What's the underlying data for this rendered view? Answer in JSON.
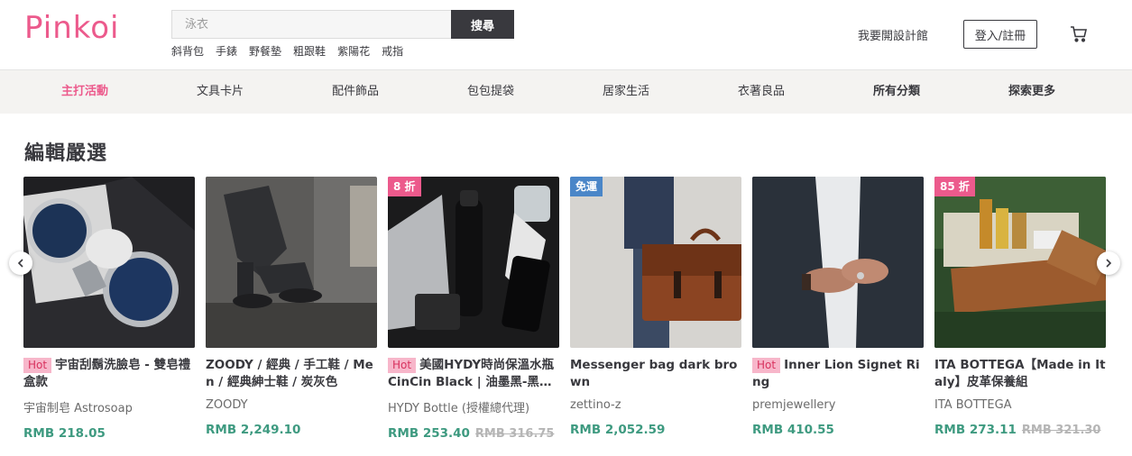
{
  "brand": {
    "logo_text": "Pinkoi",
    "color": "#ec5a8c"
  },
  "search": {
    "placeholder": "泳衣",
    "button_label": "搜尋"
  },
  "hot_words": [
    "斜背包",
    "手錶",
    "野餐墊",
    "粗跟鞋",
    "紫陽花",
    "戒指"
  ],
  "header": {
    "open_shop_label": "我要開設計館",
    "login_label": "登入/註冊",
    "cart_icon": "cart-icon"
  },
  "nav": {
    "items": [
      {
        "label": "主打活動"
      },
      {
        "label": "文具卡片"
      },
      {
        "label": "配件飾品"
      },
      {
        "label": "包包提袋"
      },
      {
        "label": "居家生活"
      },
      {
        "label": "衣著良品"
      },
      {
        "label": "所有分類"
      },
      {
        "label": "探索更多"
      }
    ]
  },
  "section": {
    "title": "編輯嚴選"
  },
  "products": [
    {
      "hot": "Hot",
      "title": "宇宙刮鬍洗臉皂 - 雙皂禮盒款",
      "shop": "宇宙制皂 Astrosoap",
      "price": "RMB 218.05"
    },
    {
      "title": "ZOODY / 經典 / 手工鞋 / Men / 經典紳士鞋 / 炭灰色",
      "shop": "ZOODY",
      "price": "RMB 2,249.10"
    },
    {
      "badge": "8 折",
      "hot": "Hot",
      "title": "美國HYDY時尚保溫水瓶 CinCin Black | 油墨黑-黑瓶身",
      "shop": "HYDY Bottle (授權總代理)",
      "price": "RMB 253.40",
      "orig_price": "RMB 316.75"
    },
    {
      "badge": "免運",
      "title": "Messenger bag dark brown",
      "shop": "zettino-z",
      "price": "RMB 2,052.59"
    },
    {
      "hot": "Hot",
      "title": "Inner Lion Signet Ring",
      "shop": "premjewellery",
      "price": "RMB 410.55"
    },
    {
      "badge": "85 折",
      "title": "ITA BOTTEGA【Made in Italy】皮革保養組",
      "shop": "ITA BOTTEGA",
      "price": "RMB 273.11",
      "orig_price": "RMB 321.30"
    }
  ],
  "colors": {
    "accent": "#ec5a8c",
    "price": "#3e9a80",
    "nav_bg": "#f4f3f1",
    "free_ship_badge": "#4a86c8"
  }
}
